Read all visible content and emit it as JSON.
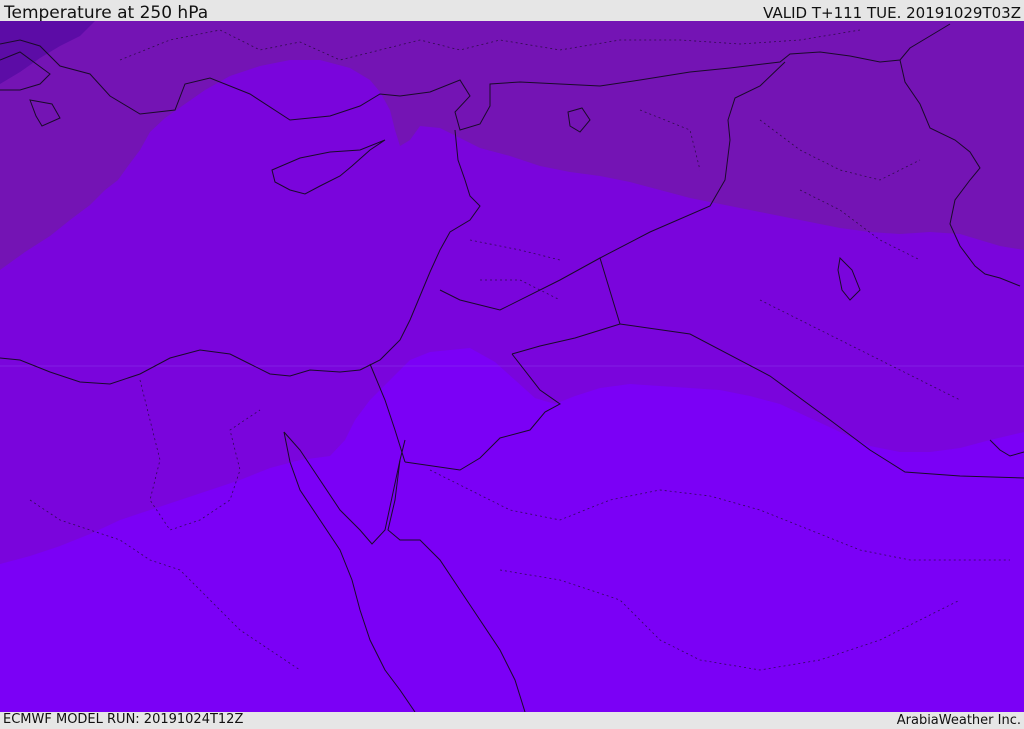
{
  "header": {
    "title": "Temperature at 250 hPa",
    "valid": "VALID T+111 TUE. 20191029T03Z"
  },
  "footer": {
    "model_run": "ECMWF MODEL RUN: 20191024T12Z",
    "credit": "ArabiaWeather Inc."
  },
  "colors": {
    "band_coldest": "#5c0ca6",
    "band_cold": "#7414b4",
    "band_mid": "#7a05dc",
    "band_warm": "#7b00f6",
    "borders": "#1a0a2a"
  }
}
